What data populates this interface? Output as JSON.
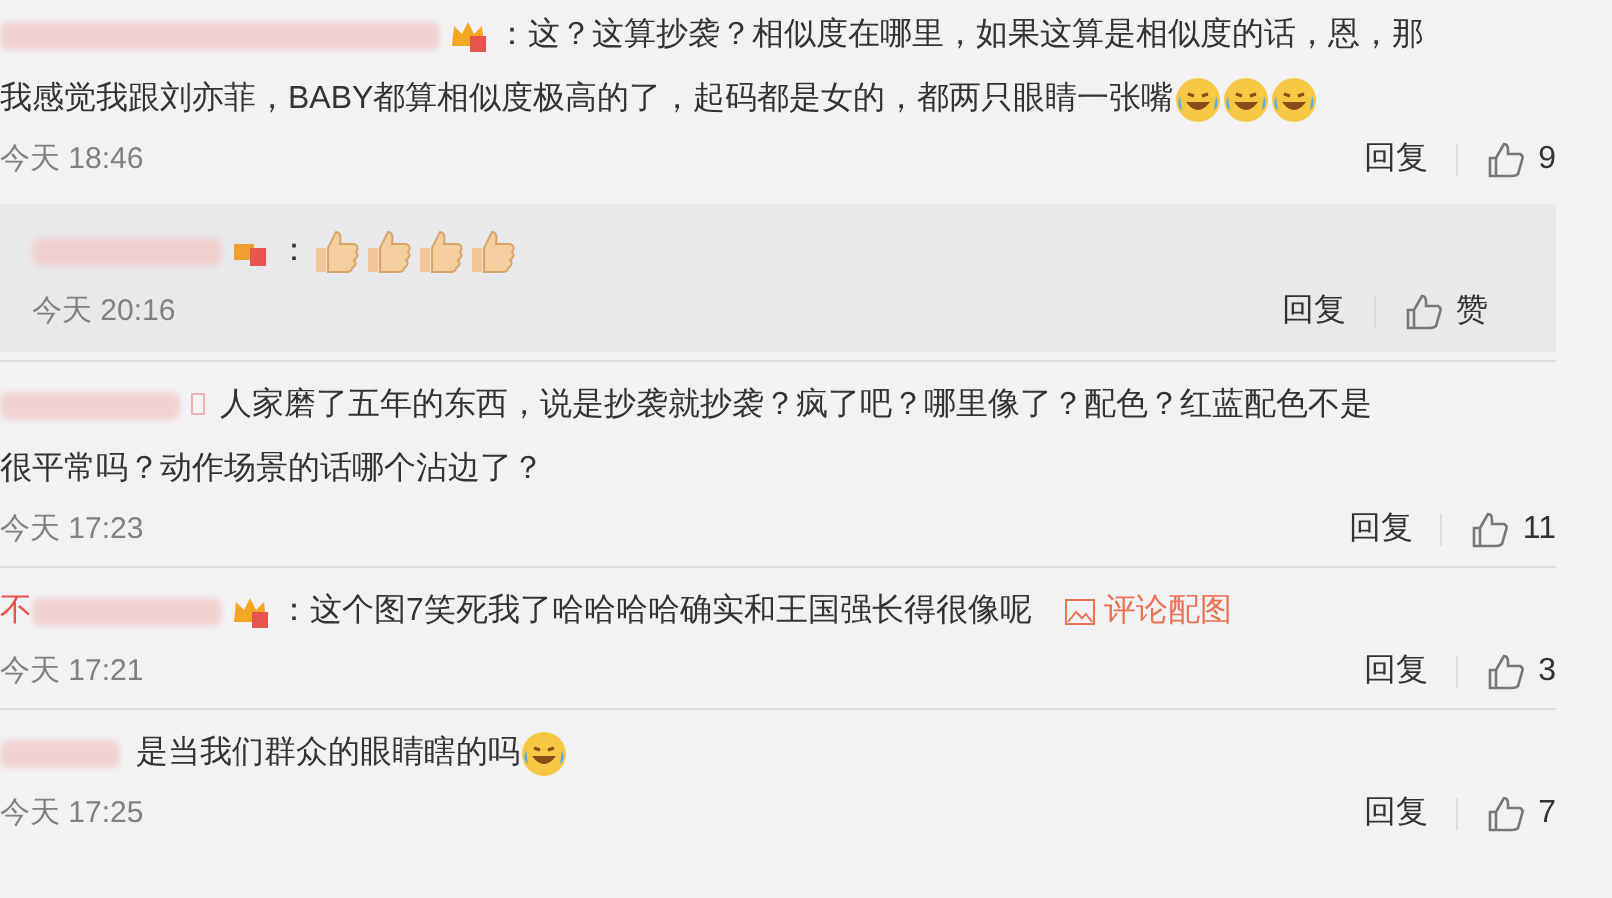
{
  "comments": [
    {
      "badge": {
        "kind": "crown"
      },
      "lines": [
        "：这？这算抄袭？相似度在哪里，如果这算是相似度的话，恩，那",
        "我感觉我跟刘亦菲，BABY都算相似度极高的了，起码都是女的，都两只眼睛一张嘴"
      ],
      "emoji": [
        {
          "kind": "laugh"
        },
        {
          "kind": "laugh"
        },
        {
          "kind": "laugh"
        }
      ],
      "time": "今天 18:46",
      "reply": "回复",
      "likes": "9",
      "replies": [
        {
          "badge": {
            "kind": "medal"
          },
          "lines": [
            "："
          ],
          "emoji": [
            {
              "kind": "thumbs_up"
            },
            {
              "kind": "thumbs_up"
            },
            {
              "kind": "thumbs_up"
            },
            {
              "kind": "thumbs_up"
            }
          ],
          "time": "今天 20:16",
          "reply": "回复",
          "likes": "赞"
        }
      ]
    },
    {
      "badge": {
        "kind": "faint"
      },
      "lines": [
        "人家磨了五年的东西，说是抄袭就抄袭？疯了吧？哪里像了？配色？红蓝配色不是",
        "很平常吗？动作场景的话哪个沾边了？"
      ],
      "time": "今天 17:23",
      "reply": "回复",
      "likes": "11"
    },
    {
      "name_prefix": "不",
      "badge": {
        "kind": "crown"
      },
      "lines": [
        "：这个图7笑死我了哈哈哈哈确实和王国强长得很像呢"
      ],
      "link": "评论配图",
      "time": "今天 17:21",
      "reply": "回复",
      "likes": "3"
    },
    {
      "lines": [
        "是当我们群众的眼睛瞎的吗"
      ],
      "emoji": [
        {
          "kind": "laugh"
        }
      ],
      "time": "今天 17:25",
      "reply": "回复",
      "likes": "7"
    }
  ]
}
